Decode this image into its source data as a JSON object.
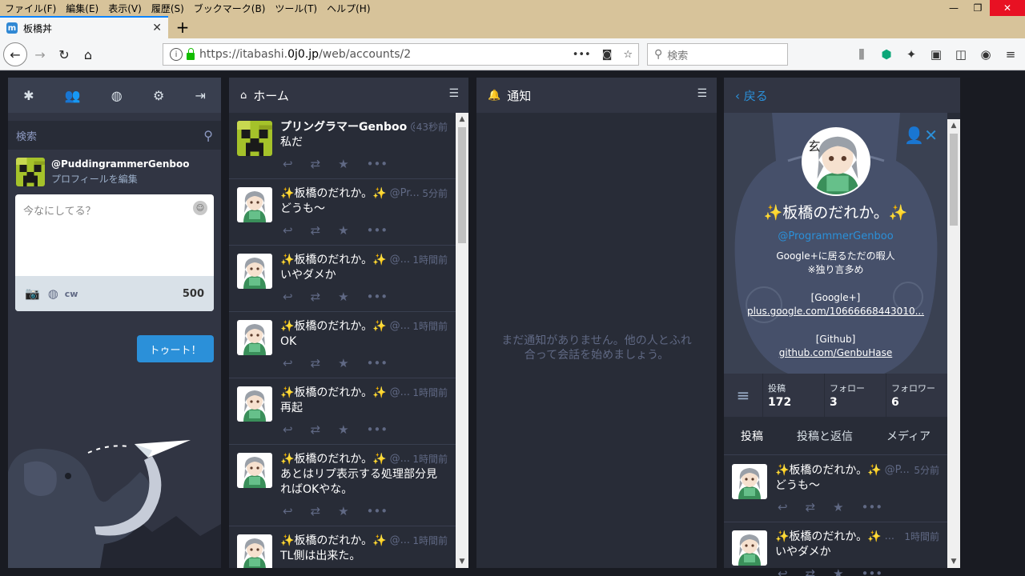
{
  "browser": {
    "menu": [
      "ファイル(F)",
      "編集(E)",
      "表示(V)",
      "履歴(S)",
      "ブックマーク(B)",
      "ツール(T)",
      "ヘルプ(H)"
    ],
    "tab_title": "板橋丼",
    "url_prefix": "https://itabashi.",
    "url_host": "0j0.jp",
    "url_path": "/web/accounts/2",
    "search_placeholder": "検索"
  },
  "drawer": {
    "search_placeholder": "検索",
    "self_name": "@PuddingrammerGenboo",
    "edit_profile": "プロフィールを編集",
    "compose_placeholder": "今なにしてる？",
    "cw": "cw",
    "char_count": "500",
    "toot_button": "トゥート！"
  },
  "home": {
    "title": "ホーム",
    "statuses": [
      {
        "name": "プリングラマーGenboo",
        "acct": "@...",
        "time": "43秒前",
        "content": "私だ",
        "avatar": "creeper"
      },
      {
        "name": "✨板橋のだれか。✨",
        "acct": "@Pr...",
        "time": "5分前",
        "content": "どうも～",
        "avatar": "girl"
      },
      {
        "name": "✨板橋のだれか。✨",
        "acct": "@...",
        "time": "1時間前",
        "content": "いやダメか",
        "avatar": "girl"
      },
      {
        "name": "✨板橋のだれか。✨",
        "acct": "@...",
        "time": "1時間前",
        "content": "OK",
        "avatar": "girl"
      },
      {
        "name": "✨板橋のだれか。✨",
        "acct": "@...",
        "time": "1時間前",
        "content": "再起",
        "avatar": "girl"
      },
      {
        "name": "✨板橋のだれか。✨",
        "acct": "@...",
        "time": "1時間前",
        "content": "あとはリプ表示する処理部分見ればOKやな。",
        "avatar": "girl"
      },
      {
        "name": "✨板橋のだれか。✨",
        "acct": "@...",
        "time": "1時間前",
        "content": "TL側は出来た。",
        "avatar": "girl"
      }
    ]
  },
  "notifications": {
    "title": "通知",
    "empty": "まだ通知がありません。他の人とふれ合って会話を始めましょう。"
  },
  "account": {
    "back": "戻る",
    "display_name": "✨板橋のだれか。✨",
    "acct": "@ProgrammerGenboo",
    "bio_line1": "Google+に居るただの暇人",
    "bio_line2": "※独り言多め",
    "bio_google_label": "[Google+]",
    "bio_google_link": "plus.google.com/10666668443010...",
    "bio_github_label": "[Github]",
    "bio_github_link": "github.com/GenbuHase",
    "counts": [
      {
        "label": "投稿",
        "value": "172"
      },
      {
        "label": "フォロー",
        "value": "3"
      },
      {
        "label": "フォロワー",
        "value": "6"
      }
    ],
    "tabs": [
      "投稿",
      "投稿と返信",
      "メディア"
    ],
    "statuses": [
      {
        "name": "✨板橋のだれか。✨",
        "acct": "@P...",
        "time": "5分前",
        "content": "どうも～"
      },
      {
        "name": "✨板橋のだれか。✨",
        "acct": "...",
        "time": "1時間前",
        "content": "いやダメか"
      }
    ]
  },
  "colors": {
    "accent": "#2b90d9",
    "column": "#282c37",
    "header": "#313543",
    "bg": "#191b22"
  }
}
